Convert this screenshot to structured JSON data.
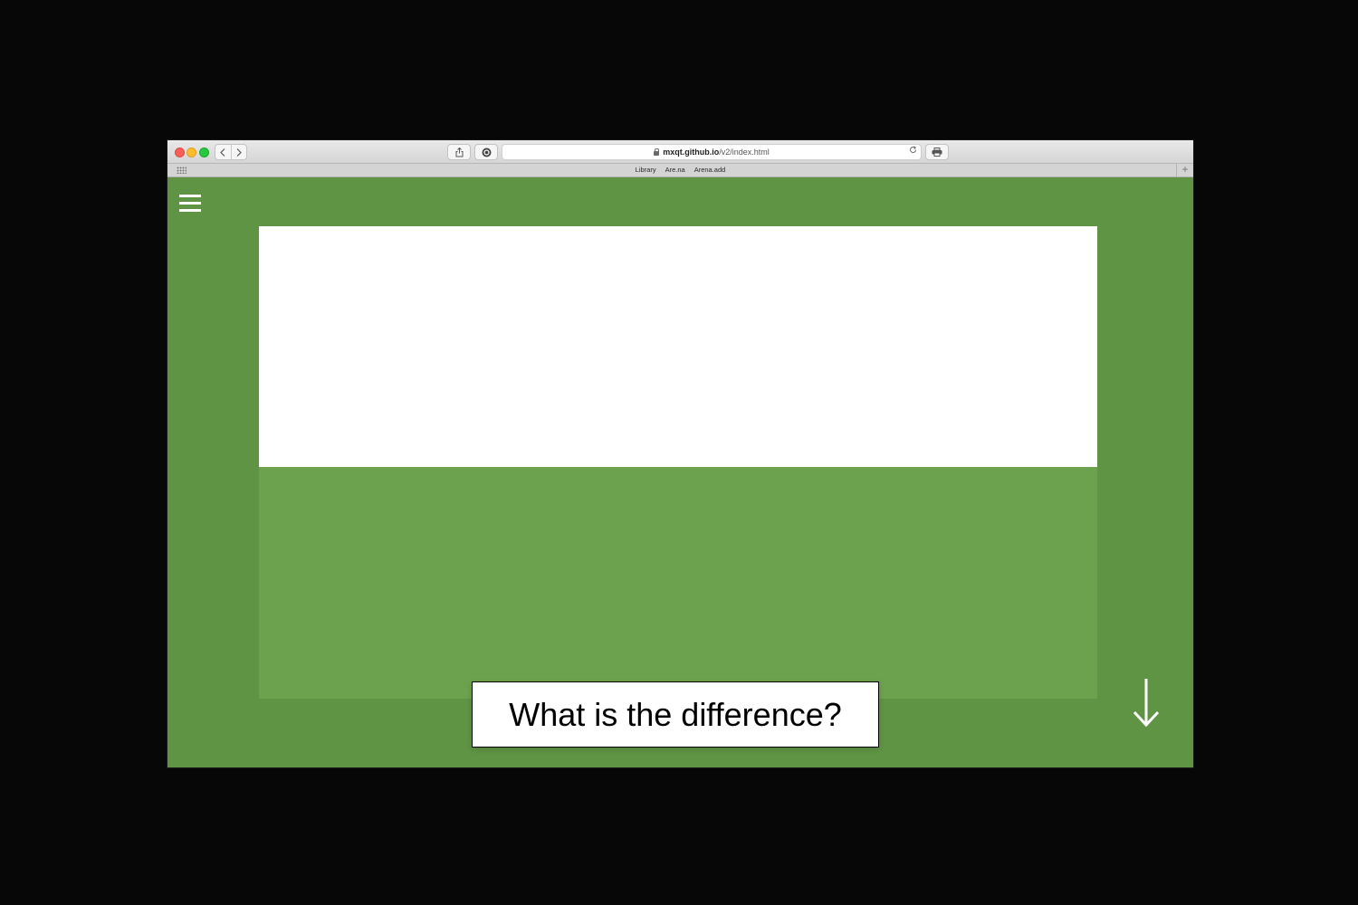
{
  "browser": {
    "url_host": "mxqt.github.io",
    "url_path": "/v2/index.html",
    "bookmarks": [
      "Library",
      "Are.na",
      "Arena.add"
    ],
    "nav_back_icon": "chevron-left-icon",
    "nav_forward_icon": "chevron-right-icon",
    "share_icon": "share-icon",
    "extension_icon": "extension-icon",
    "reload_icon": "reload-icon",
    "print_icon": "print-icon",
    "new_tab_icon": "plus-icon"
  },
  "page": {
    "caption": "What is the difference?",
    "menu_icon": "hamburger-menu-icon",
    "scroll_icon": "arrow-down-icon"
  },
  "colors": {
    "page_bg": "#5f9444",
    "panel_green": "#6ca14d",
    "panel_white": "#ffffff",
    "backdrop": "#070707"
  }
}
